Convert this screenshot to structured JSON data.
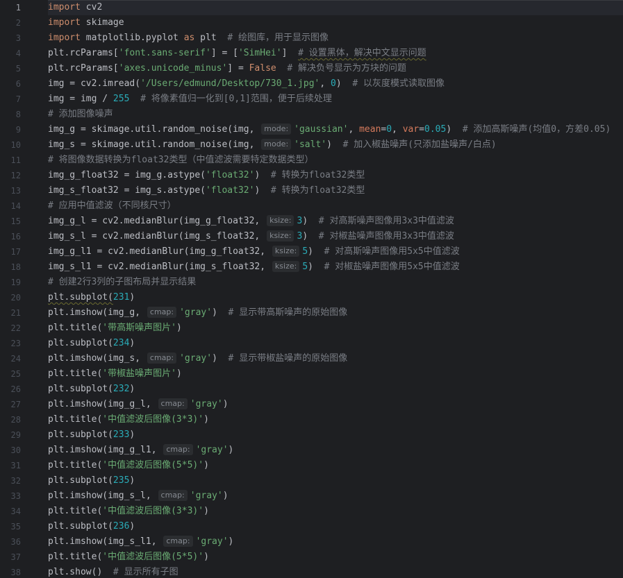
{
  "editor": {
    "current_line": 1,
    "lines": [
      {
        "n": "1",
        "t": [
          [
            "kw",
            "import"
          ],
          [
            "p",
            " cv2"
          ]
        ]
      },
      {
        "n": "2",
        "t": [
          [
            "kw",
            "import"
          ],
          [
            "p",
            " skimage"
          ]
        ]
      },
      {
        "n": "3",
        "t": [
          [
            "kw",
            "import"
          ],
          [
            "p",
            " matplotlib.pyplot "
          ],
          [
            "kw",
            "as"
          ],
          [
            "p",
            " plt  "
          ],
          [
            "cm",
            "# 绘图库，用于显示图像"
          ]
        ]
      },
      {
        "n": "4",
        "t": [
          [
            "p",
            "plt.rcParams["
          ],
          [
            "str",
            "'font.sans-serif'"
          ],
          [
            "p",
            "] = ["
          ],
          [
            "str",
            "'SimHei'"
          ],
          [
            "p",
            "]  "
          ],
          [
            "cmw",
            "# 设置黑体，解决中文显示问题"
          ]
        ]
      },
      {
        "n": "5",
        "t": [
          [
            "p",
            "plt.rcParams["
          ],
          [
            "str",
            "'axes.unicode_minus'"
          ],
          [
            "p",
            "] = "
          ],
          [
            "kw",
            "False"
          ],
          [
            "p",
            "  "
          ],
          [
            "cm",
            "# 解决负号显示为方块的问题"
          ]
        ]
      },
      {
        "n": "6",
        "t": [
          [
            "p",
            "img = cv2.imread("
          ],
          [
            "str",
            "'/Users/edmund/Desktop/730_1.jpg'"
          ],
          [
            "p",
            ", "
          ],
          [
            "num",
            "0"
          ],
          [
            "p",
            ")  "
          ],
          [
            "cm",
            "# 以灰度模式读取图像"
          ]
        ]
      },
      {
        "n": "7",
        "t": [
          [
            "p",
            "img = img / "
          ],
          [
            "num",
            "255"
          ],
          [
            "p",
            "  "
          ],
          [
            "cm",
            "# 将像素值归一化到[0,1]范围，便于后续处理"
          ]
        ]
      },
      {
        "n": "8",
        "t": [
          [
            "cm",
            "# 添加图像噪声"
          ]
        ]
      },
      {
        "n": "9",
        "t": [
          [
            "p",
            "img_g = skimage.util.random_noise(img, "
          ],
          [
            "hint",
            "mode:"
          ],
          [
            "str",
            "'gaussian'"
          ],
          [
            "p",
            ", "
          ],
          [
            "kwarg",
            "mean"
          ],
          [
            "p",
            "="
          ],
          [
            "num",
            "0"
          ],
          [
            "p",
            ", "
          ],
          [
            "kwarg",
            "var"
          ],
          [
            "p",
            "="
          ],
          [
            "num",
            "0.05"
          ],
          [
            "p",
            ")  "
          ],
          [
            "cm",
            "# 添加高斯噪声(均值0，方差0.05)"
          ]
        ]
      },
      {
        "n": "10",
        "t": [
          [
            "p",
            "img_s = skimage.util.random_noise(img, "
          ],
          [
            "hint",
            "mode:"
          ],
          [
            "str",
            "'salt'"
          ],
          [
            "p",
            ")  "
          ],
          [
            "cm",
            "# 加入椒盐噪声(只添加盐噪声/白点)"
          ]
        ]
      },
      {
        "n": "11",
        "t": [
          [
            "cm",
            "# 将图像数据转换为float32类型（中值滤波需要特定数据类型）"
          ]
        ]
      },
      {
        "n": "12",
        "t": [
          [
            "p",
            "img_g_float32 = img_g.astype("
          ],
          [
            "str",
            "'float32'"
          ],
          [
            "p",
            ")  "
          ],
          [
            "cm",
            "# 转换为float32类型"
          ]
        ]
      },
      {
        "n": "13",
        "t": [
          [
            "p",
            "img_s_float32 = img_s.astype("
          ],
          [
            "str",
            "'float32'"
          ],
          [
            "p",
            ")  "
          ],
          [
            "cm",
            "# 转换为float32类型"
          ]
        ]
      },
      {
        "n": "14",
        "t": [
          [
            "cm",
            "# 应用中值滤波（不同核尺寸）"
          ]
        ]
      },
      {
        "n": "15",
        "t": [
          [
            "p",
            "img_g_l = cv2.medianBlur(img_g_float32, "
          ],
          [
            "hint",
            "ksize:"
          ],
          [
            "num",
            "3"
          ],
          [
            "p",
            ")  "
          ],
          [
            "cm",
            "# 对高斯噪声图像用3x3中值滤波"
          ]
        ]
      },
      {
        "n": "16",
        "t": [
          [
            "p",
            "img_s_l = cv2.medianBlur(img_s_float32, "
          ],
          [
            "hint",
            "ksize:"
          ],
          [
            "num",
            "3"
          ],
          [
            "p",
            ")  "
          ],
          [
            "cm",
            "# 对椒盐噪声图像用3x3中值滤波"
          ]
        ]
      },
      {
        "n": "17",
        "t": [
          [
            "p",
            "img_g_l1 = cv2.medianBlur(img_g_float32, "
          ],
          [
            "hint",
            "ksize:"
          ],
          [
            "num",
            "5"
          ],
          [
            "p",
            ")  "
          ],
          [
            "cm",
            "# 对高斯噪声图像用5x5中值滤波"
          ]
        ]
      },
      {
        "n": "18",
        "t": [
          [
            "p",
            "img_s_l1 = cv2.medianBlur(img_s_float32, "
          ],
          [
            "hint",
            "ksize:"
          ],
          [
            "num",
            "5"
          ],
          [
            "p",
            ")  "
          ],
          [
            "cm",
            "# 对椒盐噪声图像用5x5中值滤波"
          ]
        ]
      },
      {
        "n": "19",
        "t": [
          [
            "cm",
            "# 创建2行3列的子图布局并显示结果"
          ]
        ]
      },
      {
        "n": "20",
        "t": [
          [
            "pw",
            "plt.subplot("
          ],
          [
            "num",
            "231"
          ],
          [
            "p",
            ")"
          ]
        ]
      },
      {
        "n": "21",
        "t": [
          [
            "p",
            "plt.imshow(img_g, "
          ],
          [
            "hint",
            "cmap:"
          ],
          [
            "str",
            "'gray'"
          ],
          [
            "p",
            ")  "
          ],
          [
            "cm",
            "# 显示带高斯噪声的原始图像"
          ]
        ]
      },
      {
        "n": "22",
        "t": [
          [
            "p",
            "plt.title("
          ],
          [
            "str",
            "'带高斯噪声图片'"
          ],
          [
            "p",
            ")"
          ]
        ]
      },
      {
        "n": "23",
        "t": [
          [
            "p",
            "plt.subplot("
          ],
          [
            "num",
            "234"
          ],
          [
            "p",
            ")"
          ]
        ]
      },
      {
        "n": "24",
        "t": [
          [
            "p",
            "plt.imshow(img_s, "
          ],
          [
            "hint",
            "cmap:"
          ],
          [
            "str",
            "'gray'"
          ],
          [
            "p",
            ")  "
          ],
          [
            "cm",
            "# 显示带椒盐噪声的原始图像"
          ]
        ]
      },
      {
        "n": "25",
        "t": [
          [
            "p",
            "plt.title("
          ],
          [
            "str",
            "'带椒盐噪声图片'"
          ],
          [
            "p",
            ")"
          ]
        ]
      },
      {
        "n": "26",
        "t": [
          [
            "p",
            "plt.subplot("
          ],
          [
            "num",
            "232"
          ],
          [
            "p",
            ")"
          ]
        ]
      },
      {
        "n": "27",
        "t": [
          [
            "p",
            "plt.imshow(img_g_l, "
          ],
          [
            "hint",
            "cmap:"
          ],
          [
            "str",
            "'gray'"
          ],
          [
            "p",
            ")"
          ]
        ]
      },
      {
        "n": "28",
        "t": [
          [
            "p",
            "plt.title("
          ],
          [
            "str",
            "'中值滤波后图像(3*3)'"
          ],
          [
            "p",
            ")"
          ]
        ]
      },
      {
        "n": "29",
        "t": [
          [
            "p",
            "plt.subplot("
          ],
          [
            "num",
            "233"
          ],
          [
            "p",
            ")"
          ]
        ]
      },
      {
        "n": "30",
        "t": [
          [
            "p",
            "plt.imshow(img_g_l1, "
          ],
          [
            "hint",
            "cmap:"
          ],
          [
            "str",
            "'gray'"
          ],
          [
            "p",
            ")"
          ]
        ]
      },
      {
        "n": "31",
        "t": [
          [
            "p",
            "plt.title("
          ],
          [
            "str",
            "'中值滤波后图像(5*5)'"
          ],
          [
            "p",
            ")"
          ]
        ]
      },
      {
        "n": "32",
        "t": [
          [
            "p",
            "plt.subplot("
          ],
          [
            "num",
            "235"
          ],
          [
            "p",
            ")"
          ]
        ]
      },
      {
        "n": "33",
        "t": [
          [
            "p",
            "plt.imshow(img_s_l, "
          ],
          [
            "hint",
            "cmap:"
          ],
          [
            "str",
            "'gray'"
          ],
          [
            "p",
            ")"
          ]
        ]
      },
      {
        "n": "34",
        "t": [
          [
            "p",
            "plt.title("
          ],
          [
            "str",
            "'中值滤波后图像(3*3)'"
          ],
          [
            "p",
            ")"
          ]
        ]
      },
      {
        "n": "35",
        "t": [
          [
            "p",
            "plt.subplot("
          ],
          [
            "num",
            "236"
          ],
          [
            "p",
            ")"
          ]
        ]
      },
      {
        "n": "36",
        "t": [
          [
            "p",
            "plt.imshow(img_s_l1, "
          ],
          [
            "hint",
            "cmap:"
          ],
          [
            "str",
            "'gray'"
          ],
          [
            "p",
            ")"
          ]
        ]
      },
      {
        "n": "37",
        "t": [
          [
            "p",
            "plt.title("
          ],
          [
            "str",
            "'中值滤波后图像(5*5)'"
          ],
          [
            "p",
            ")"
          ]
        ]
      },
      {
        "n": "38",
        "t": [
          [
            "p",
            "plt.show()  "
          ],
          [
            "cm",
            "# 显示所有子图"
          ]
        ]
      }
    ]
  }
}
